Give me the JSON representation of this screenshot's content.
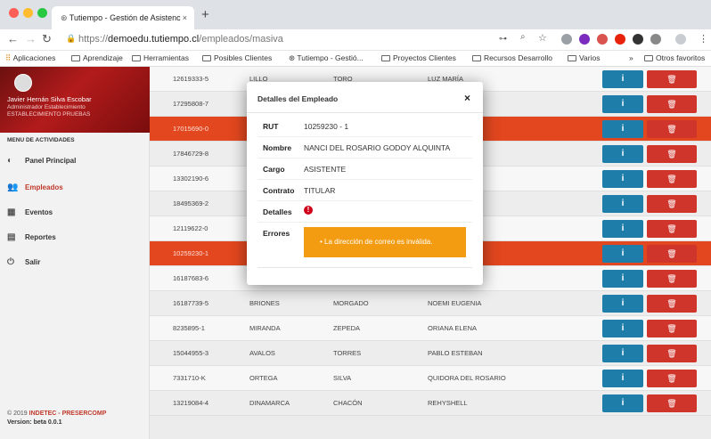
{
  "browser": {
    "tab_title": "Tutiempo - Gestión de Asistenc",
    "url_scheme": "https://",
    "url_host": "demoedu.tutiempo.cl",
    "url_path": "/empleados/masiva",
    "bookmarks": [
      "Aplicaciones",
      "Aprendizaje",
      "Herramientas",
      "Posibles Clientes",
      "Tutiempo - Gestió...",
      "Proyectos Clientes",
      "Recursos Desarrollo",
      "Varios"
    ],
    "bookmarks_more": "»",
    "bookmarks_other": "Otros favoritos"
  },
  "sidebar": {
    "user_name": "Javier Hernán Silva Escobar",
    "user_role": "Administrador Establecimiento",
    "user_establishment": "ESTABLECIMIENTO PRUEBAS",
    "menu_title": "MENU DE ACTIVIDADES",
    "items": [
      {
        "label": "Panel Principal",
        "icon": "dashboard-icon"
      },
      {
        "label": "Empleados",
        "icon": "users-icon"
      },
      {
        "label": "Eventos",
        "icon": "calendar-icon"
      },
      {
        "label": "Reportes",
        "icon": "report-icon"
      },
      {
        "label": "Salir",
        "icon": "power-icon"
      }
    ],
    "footer_copy": "© 2019",
    "footer_brand": "INDETEC - PRESERCOMP",
    "footer_version": "Version: beta 0.0.1"
  },
  "table": {
    "rows": [
      [
        "12619333-5",
        "LILLO",
        "TORO",
        "LUZ MARÍA"
      ],
      [
        "17295808-7",
        "",
        "",
        "LE"
      ],
      [
        "17015690-0",
        "",
        "",
        "NORINA"
      ],
      [
        "17846729-8",
        "",
        "",
        "NGELES"
      ],
      [
        "13302190-6",
        "",
        "",
        ""
      ],
      [
        "18495369-2",
        "",
        "",
        ""
      ],
      [
        "12119622-0",
        "",
        "",
        "EN"
      ],
      [
        "10259230-1",
        "",
        "",
        "RIO"
      ],
      [
        "16187683-6",
        "ROJAS",
        "ARANCIBIA",
        "NATALIA CECILIA"
      ],
      [
        "16187739-5",
        "BRIONES",
        "MORGADO",
        "NOEMI EUGENIA"
      ],
      [
        "8235895-1",
        "MIRANDA",
        "ZEPEDA",
        "ORIANA ELENA"
      ],
      [
        "15044955-3",
        "AVALOS",
        "TORRES",
        "PABLO ESTEBAN"
      ],
      [
        "7331710-K",
        "ORTEGA",
        "SILVA",
        "QUIDORA DEL ROSARIO"
      ],
      [
        "13219084-4",
        "DINAMARCA",
        "CHACÓN",
        "REHYSHELL"
      ]
    ],
    "info_btn": "i",
    "delete_btn": "🗑"
  },
  "modal": {
    "title": "Detalles del Empleado",
    "close": "×",
    "labels": {
      "rut": "RUT",
      "nombre": "Nombre",
      "cargo": "Cargo",
      "contrato": "Contrato",
      "detalles": "Detalles",
      "errores": "Errores"
    },
    "rut": "10259230 - 1",
    "nombre": "NANCI DEL ROSARIO GODOY ALQUINTA",
    "cargo": "ASISTENTE",
    "contrato": "TITULAR",
    "detalles_icon": "!",
    "error_message": "La dirección de correo es inválida."
  },
  "colors": {
    "accent_red": "#c0392b",
    "highlight_row": "#e2471f",
    "info_blue": "#1f7ea9",
    "delete_red": "#d0352c",
    "error_orange": "#f39c12"
  }
}
